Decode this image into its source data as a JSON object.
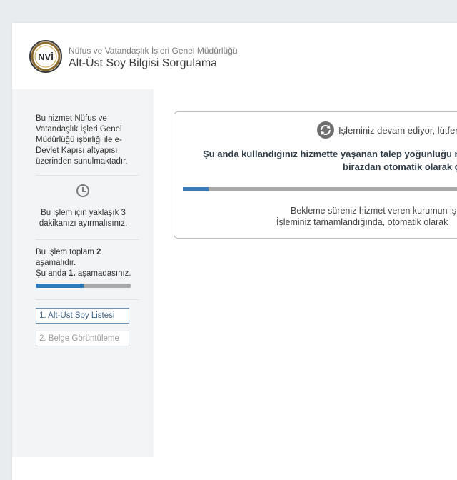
{
  "header": {
    "org_name": "Nüfus ve Vatandaşlık İşleri Genel Müdürlüğü",
    "page_title": "Alt-Üst Soy Bilgisi Sorgulama",
    "logo_text": "NVİ"
  },
  "sidebar": {
    "info_lines": [
      "Bu hizmet Nüfus ve",
      "Vatandaşlık İşleri Genel",
      "Müdürlüğü işbirliği ile e-",
      "Devlet Kapısı altyapısı",
      "üzerinden sunulmaktadır."
    ],
    "time_lines": [
      "Bu işlem için yaklaşık 3",
      "dakikanızı ayırmalısınız."
    ],
    "stage_total_prefix": "Bu işlem toplam ",
    "stage_total_value": "2",
    "stage_total_suffix": "aşamalıdır.",
    "stage_current_prefix": "Şu anda ",
    "stage_current_value": "1.",
    "stage_current_suffix": " aşamadasınız.",
    "stage_progress": 0.5,
    "steps": [
      {
        "label": "1. Alt-Üst Soy Listesi"
      },
      {
        "label": "2. Belge Görüntüleme"
      }
    ]
  },
  "notice": {
    "status": "İşleminiz devam ediyor, lütfen",
    "bold_line_1": "Şu anda kullandığınız hizmette yaşanan talep yoğunluğu ne",
    "bold_line_2": "birazdan otomatik olarak g",
    "wait_progress": 0.09,
    "wait_line_1": "Bekleme süreniz hizmet veren kurumun iş",
    "wait_line_2": "İşleminiz tamamlandığında, otomatik olarak"
  },
  "colors": {
    "accent": "#2f7ab9",
    "progress_bg": "#a9a9a9",
    "page_bg": "#e9ecef"
  }
}
